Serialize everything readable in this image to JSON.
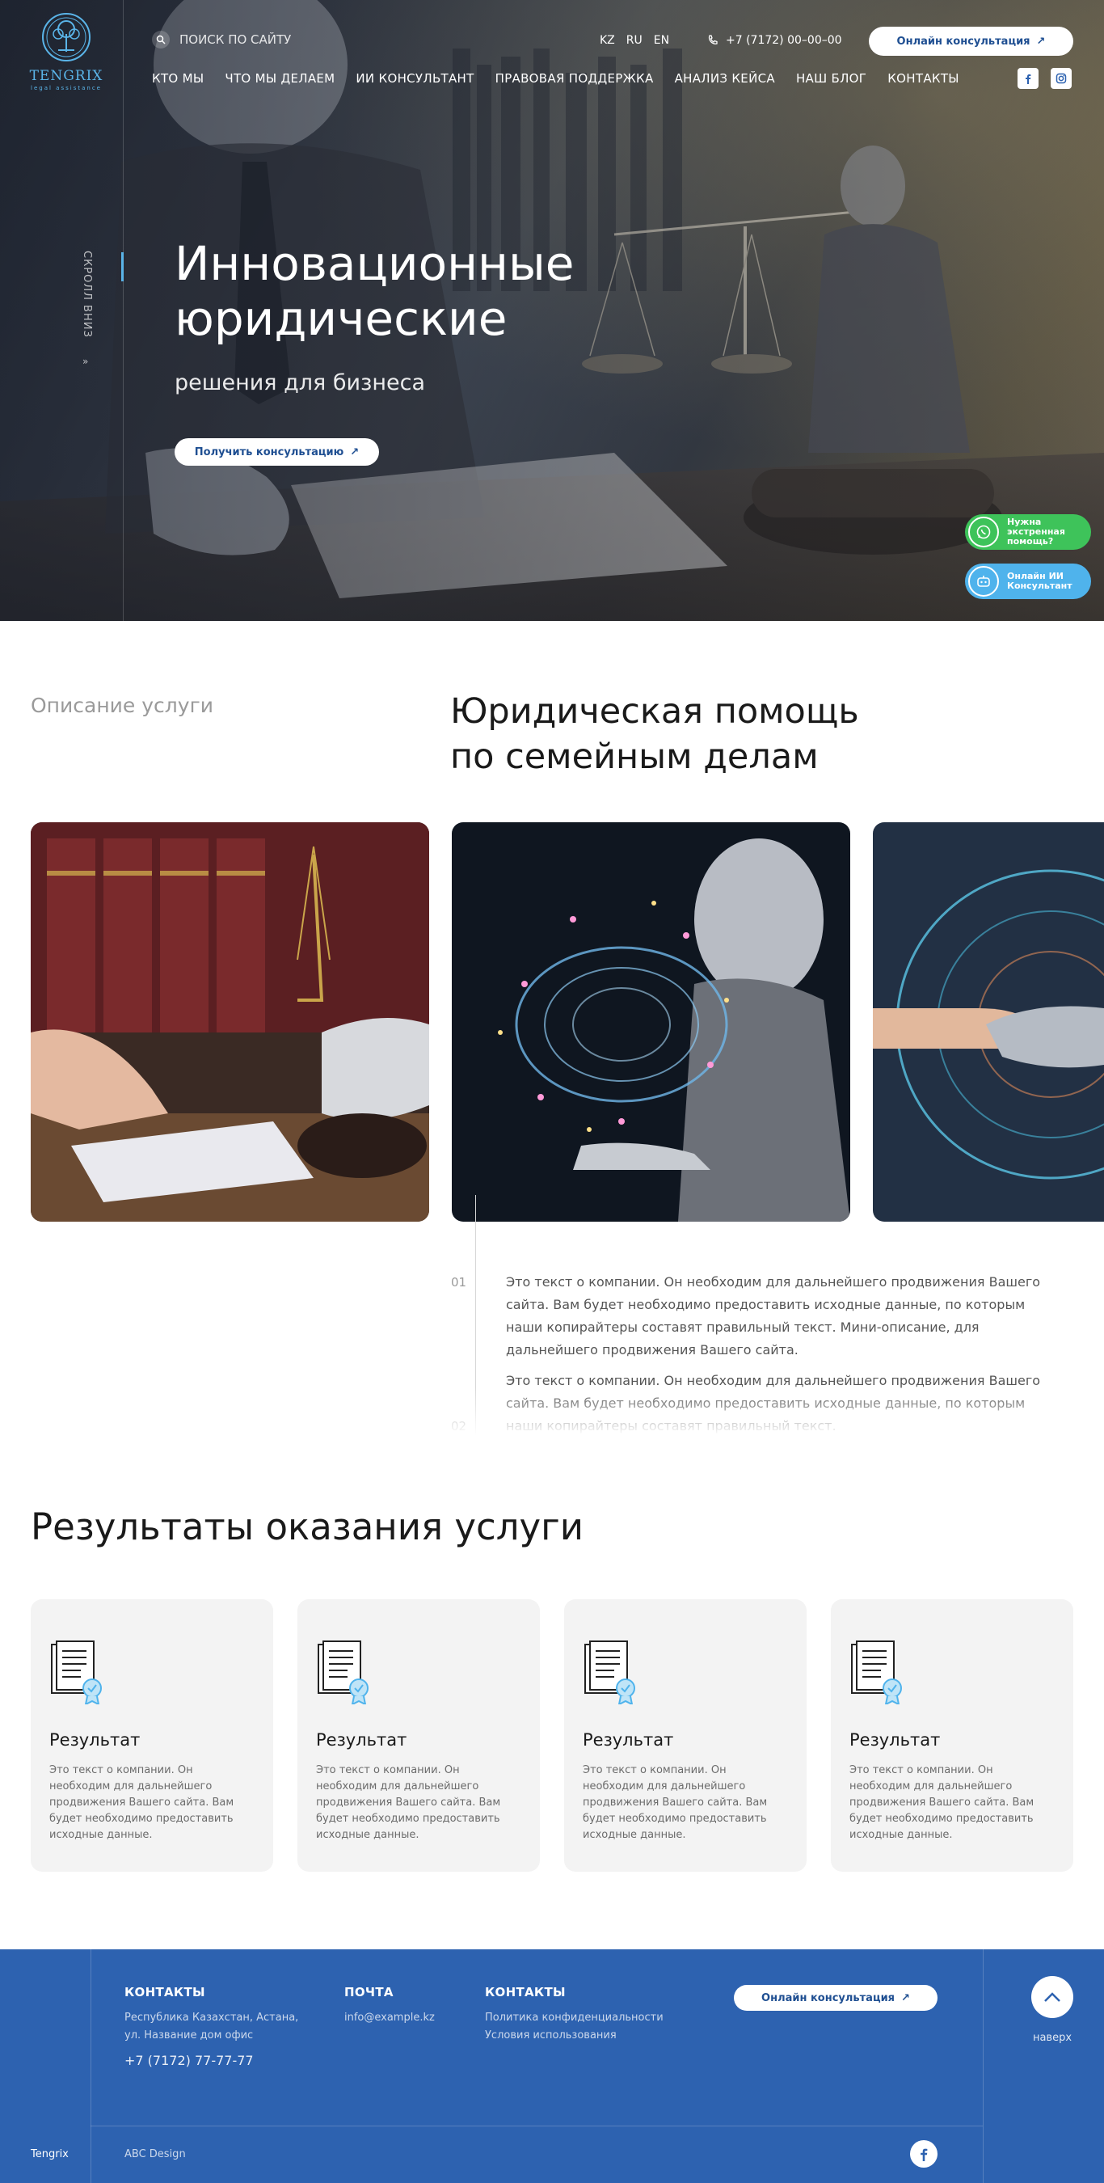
{
  "brand": {
    "name": "TENGRIX",
    "tagline": "legal assistance"
  },
  "header": {
    "search_label": "ПОИСК ПО САЙТУ",
    "langs": [
      "KZ",
      "RU",
      "EN"
    ],
    "phone": "+7 (7172) 00–00–00",
    "consult_label": "Онлайн консультация",
    "nav": [
      "КТО МЫ",
      "ЧТО МЫ ДЕЛАЕМ",
      "ИИ КОНСУЛЬТАНТ",
      "ПРАВОВАЯ ПОДДЕРЖКА",
      "АНАЛИЗ КЕЙСА",
      "НАШ БЛОГ",
      "КОНТАКТЫ"
    ]
  },
  "hero": {
    "title_line1": "Инновационные",
    "title_line2": "юридические",
    "subtitle": "решения для бизнеса",
    "cta": "Получить консультацию",
    "scroll_label": "СКРОЛЛ ВНИЗ"
  },
  "floating": {
    "emergency": "Нужна экстренная помощь?",
    "ai": "Онлайн ИИ Консультант"
  },
  "service": {
    "label": "Описание услуги",
    "title_line1": "Юридическая помощь",
    "title_line2": "по семейным делам",
    "items": [
      {
        "num": "01",
        "text": "Это текст о компании. Он необходим для дальнейшего продвижения Вашего сайта. Вам будет необходимо предоставить исходные данные, по которым наши копирайтеры составят правильный текст. Мини-описание, для дальнейшего продвижения Вашего сайта."
      },
      {
        "num": "02",
        "text": "Это текст о компании. Он необходим для дальнейшего продвижения Вашего сайта. Вам будет необходимо предоставить исходные данные, по которым наши копирайтеры составят правильный текст."
      }
    ]
  },
  "results": {
    "title": "Результаты оказания услуги",
    "cards": [
      {
        "title": "Результат",
        "text": "Это текст о компании. Он необходим для дальнейшего продвижения Вашего сайта. Вам будет необходимо предоставить исходные данные."
      },
      {
        "title": "Результат",
        "text": "Это текст о компании. Он необходим для дальнейшего продвижения Вашего сайта. Вам будет необходимо предоставить исходные данные."
      },
      {
        "title": "Результат",
        "text": "Это текст о компании. Он необходим для дальнейшего продвижения Вашего сайта. Вам будет необходимо предоставить исходные данные."
      },
      {
        "title": "Результат",
        "text": "Это текст о компании. Он необходим для дальнейшего продвижения Вашего сайта. Вам будет необходимо предоставить исходные данные."
      }
    ]
  },
  "footer": {
    "contacts_h": "КОНТАКТЫ",
    "address_1": "Республика Казахстан, Астана,",
    "address_2": "ул. Название дом офис",
    "phone": "+7 (7172) 77-77-77",
    "mail_h": "ПОЧТА",
    "email": "info@example.kz",
    "links_h": "КОНТАКТЫ",
    "privacy": "Политика конфиденциальности",
    "terms": "Условия использования",
    "consult_label": "Онлайн консультация",
    "up_label": "наверх",
    "brand": "Tengrix",
    "credit": "ABC Design"
  },
  "colors": {
    "accent": "#2d62b0",
    "light_blue": "#5ab4e8",
    "whatsapp": "#3ec35a",
    "ai": "#4fb3ec"
  }
}
